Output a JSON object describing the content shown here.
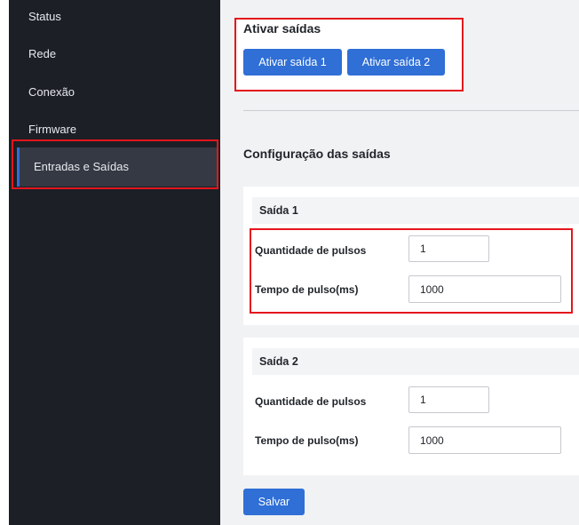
{
  "sidebar": {
    "items": [
      {
        "label": "Status"
      },
      {
        "label": "Rede"
      },
      {
        "label": "Conexão"
      },
      {
        "label": "Firmware"
      },
      {
        "label": "Entradas e Saídas"
      }
    ],
    "active_index": 4
  },
  "activate_outputs": {
    "title": "Ativar saídas",
    "button_1": "Ativar saída 1",
    "button_2": "Ativar saída 2"
  },
  "config": {
    "title": "Configuração das saídas",
    "outputs": [
      {
        "name": "Saída 1",
        "pulse_qty_label": "Quantidade de pulsos",
        "pulse_qty_value": "1",
        "pulse_time_label": "Tempo de pulso(ms)",
        "pulse_time_value": "1000"
      },
      {
        "name": "Saída 2",
        "pulse_qty_label": "Quantidade de pulsos",
        "pulse_qty_value": "1",
        "pulse_time_label": "Tempo de pulso(ms)",
        "pulse_time_value": "1000"
      }
    ]
  },
  "save_label": "Salvar",
  "colors": {
    "sidebar_bg": "#1c1f26",
    "accent": "#2f6fd6",
    "highlight": "#e4161c"
  }
}
